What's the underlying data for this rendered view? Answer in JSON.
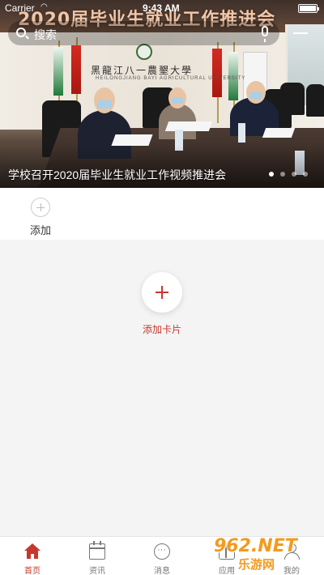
{
  "status_bar": {
    "carrier": "Carrier",
    "time": "9:43 AM"
  },
  "banner": {
    "screen_title": "2020届毕业生就业工作推进会",
    "university_name": "黑龍江八一農墾大學",
    "university_sub": "HEILONGJIANG BAYI AGRICULTURAL UNIVERSITY",
    "caption": "学校召开2020届毕业生就业工作视频推进会",
    "slide_count": 4,
    "active_slide": 1
  },
  "search": {
    "placeholder": "搜索"
  },
  "add_section": {
    "label": "添加"
  },
  "add_card": {
    "label": "添加卡片"
  },
  "tabs": [
    {
      "label": "首页",
      "icon": "home-icon",
      "active": true
    },
    {
      "label": "资讯",
      "icon": "calendar-icon",
      "active": false
    },
    {
      "label": "消息",
      "icon": "chat-icon",
      "active": false
    },
    {
      "label": "应用",
      "icon": "grid-icon",
      "active": false
    },
    {
      "label": "我的",
      "icon": "user-icon",
      "active": false
    }
  ],
  "watermark": {
    "logo": "962.NET",
    "sub": "乐游网"
  },
  "colors": {
    "accent": "#c8372d",
    "background": "#f4f4f4",
    "tab_inactive": "#777777"
  }
}
